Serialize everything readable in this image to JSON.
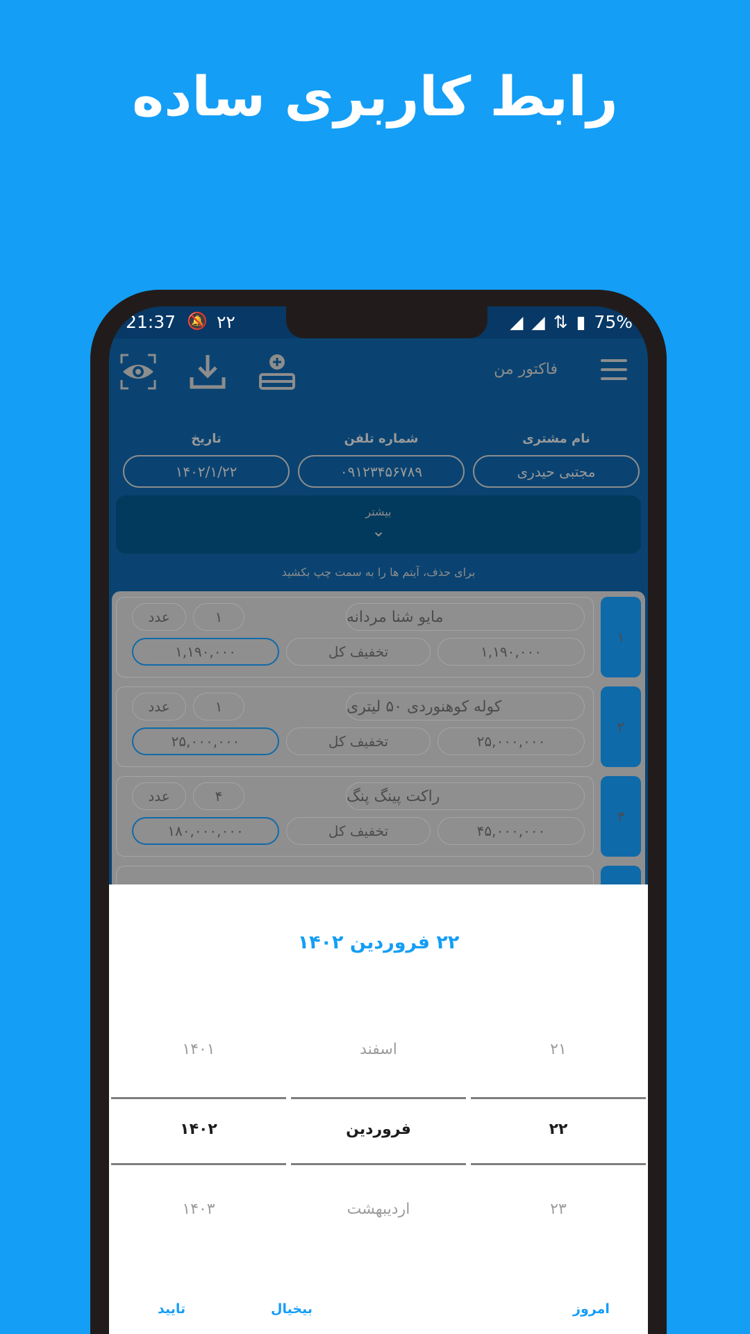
{
  "headline": "رابط کاربری ساده",
  "status": {
    "time": "21:37",
    "notif": "۲۲",
    "battery": "75%"
  },
  "appbar": {
    "title": "فاکتور من"
  },
  "form": {
    "customer_label": "نام مشتری",
    "customer_value": "مجتبی حیدری",
    "phone_label": "شماره تلفن",
    "phone_value": "۰۹۱۲۳۴۵۶۷۸۹",
    "date_label": "تاریخ",
    "date_value": "۱۴۰۲/۱/۲۲"
  },
  "more_label": "بیشتر",
  "hint": "برای حذف، آیتم ها را به سمت چپ بکشید",
  "items": [
    {
      "num": "۱",
      "name": "مایو شنا مردانه",
      "qty": "۱",
      "unit": "عدد",
      "price": "۱,۱۹۰,۰۰۰",
      "discount": "تخفیف کل",
      "total": "۱,۱۹۰,۰۰۰"
    },
    {
      "num": "۲",
      "name": "کوله کوهنوردی ۵۰ لیتری",
      "qty": "۱",
      "unit": "عدد",
      "price": "۲۵,۰۰۰,۰۰۰",
      "discount": "تخفیف کل",
      "total": "۲۵,۰۰۰,۰۰۰"
    },
    {
      "num": "۳",
      "name": "راکت پینگ پنگ",
      "qty": "۴",
      "unit": "عدد",
      "price": "۴۵,۰۰۰,۰۰۰",
      "discount": "تخفیف کل",
      "total": "۱۸۰,۰۰۰,۰۰۰"
    }
  ],
  "picker": {
    "title": "۲۲ فروردین ۱۴۰۲",
    "years": [
      "۱۴۰۱",
      "۱۴۰۲",
      "۱۴۰۳"
    ],
    "months": [
      "اسفند",
      "فروردین",
      "اردیبهشت"
    ],
    "days": [
      "۲۱",
      "۲۲",
      "۲۳"
    ],
    "confirm": "تایید",
    "cancel": "بیخیال",
    "today": "امروز"
  },
  "colors": {
    "background": "#149ef6",
    "accent": "#149ef6",
    "dark_bar": "#073866"
  }
}
